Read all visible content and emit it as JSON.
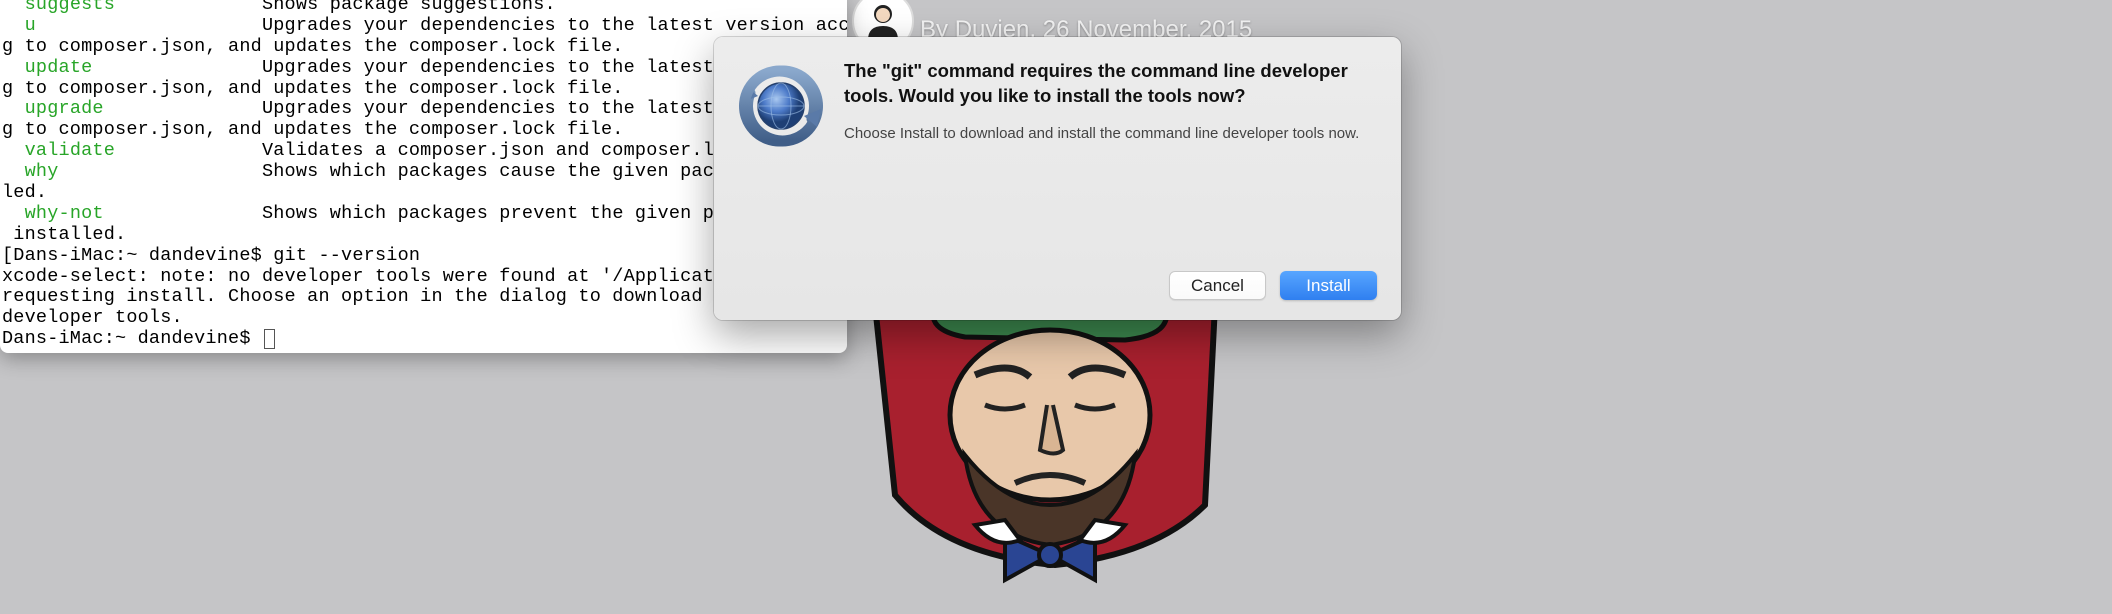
{
  "terminal": {
    "lines": [
      {
        "segments": [
          {
            "t": "  ",
            "c": ""
          },
          {
            "t": "suggests",
            "c": "cmd-green"
          },
          {
            "t": "             Shows package suggestions.",
            "c": ""
          }
        ]
      },
      {
        "segments": [
          {
            "t": "  ",
            "c": ""
          },
          {
            "t": "u",
            "c": "cmd-green"
          },
          {
            "t": "                    Upgrades your dependencies to the latest version accordin",
            "c": ""
          }
        ]
      },
      {
        "segments": [
          {
            "t": "g to composer.json, and updates the composer.lock file.",
            "c": ""
          }
        ]
      },
      {
        "segments": [
          {
            "t": "  ",
            "c": ""
          },
          {
            "t": "update",
            "c": "cmd-green"
          },
          {
            "t": "               Upgrades your dependencies to the latest vers",
            "c": ""
          }
        ]
      },
      {
        "segments": [
          {
            "t": "g to composer.json, and updates the composer.lock file.",
            "c": ""
          }
        ]
      },
      {
        "segments": [
          {
            "t": "  ",
            "c": ""
          },
          {
            "t": "upgrade",
            "c": "cmd-green"
          },
          {
            "t": "              Upgrades your dependencies to the latest vers",
            "c": ""
          }
        ]
      },
      {
        "segments": [
          {
            "t": "g to composer.json, and updates the composer.lock file.",
            "c": ""
          }
        ]
      },
      {
        "segments": [
          {
            "t": "  ",
            "c": ""
          },
          {
            "t": "validate",
            "c": "cmd-green"
          },
          {
            "t": "             Validates a composer.json and composer.lock.",
            "c": ""
          }
        ]
      },
      {
        "segments": [
          {
            "t": "  ",
            "c": ""
          },
          {
            "t": "why",
            "c": "cmd-green"
          },
          {
            "t": "                  Shows which packages cause the given package",
            "c": ""
          }
        ]
      },
      {
        "segments": [
          {
            "t": "led.",
            "c": ""
          }
        ]
      },
      {
        "segments": [
          {
            "t": "  ",
            "c": ""
          },
          {
            "t": "why-not",
            "c": "cmd-green"
          },
          {
            "t": "              Shows which packages prevent the given packag",
            "c": ""
          }
        ]
      },
      {
        "segments": [
          {
            "t": " installed.",
            "c": ""
          }
        ]
      },
      {
        "segments": [
          {
            "t": "[Dans-iMac:~ dandevine$ git --version",
            "c": ""
          }
        ]
      },
      {
        "segments": [
          {
            "t": "xcode-select: note: no developer tools were found at '/Applications,",
            "c": ""
          }
        ]
      },
      {
        "segments": [
          {
            "t": "requesting install. Choose an option in the dialog to download the o",
            "c": ""
          }
        ]
      },
      {
        "segments": [
          {
            "t": "developer tools.",
            "c": ""
          }
        ]
      }
    ],
    "prompt": "Dans-iMac:~ dandevine$ "
  },
  "byline": {
    "prefix": "By ",
    "author": "Duvien",
    "separator": ", ",
    "date": "26 November, 2015"
  },
  "dialog": {
    "heading": "The \"git\" command requires the command line developer tools. Would you like to install the tools now?",
    "message": "Choose Install to download and install the command line developer tools now.",
    "cancel": "Cancel",
    "install": "Install"
  }
}
